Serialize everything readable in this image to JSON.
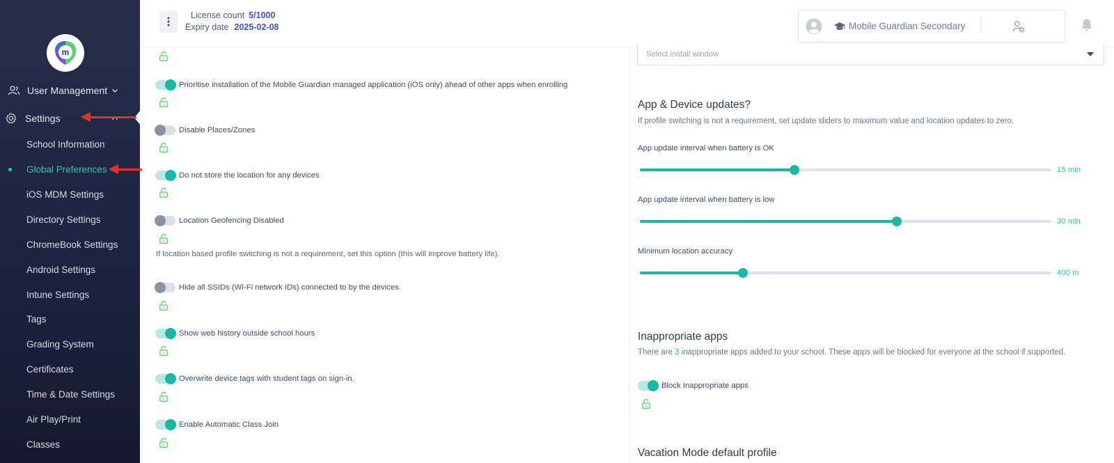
{
  "sidebar": {
    "user_management": "User Management",
    "settings": "Settings",
    "sub_items": [
      "School Information",
      "Global Preferences",
      "iOS MDM Settings",
      "Directory Settings",
      "ChromeBook Settings",
      "Android Settings",
      "Intune Settings",
      "Tags",
      "Grading System",
      "Certificates",
      "Time & Date Settings",
      "Air Play/Print",
      "Classes"
    ],
    "active_item": "Global Preferences"
  },
  "header": {
    "license_label": "License count",
    "license_value": "5/1000",
    "expiry_label": "Expiry date",
    "expiry_value": "2025-02-08",
    "school_name": "Mobile Guardian Secondary"
  },
  "left_settings": [
    {
      "label": "Prioritise installation of the Mobile Guardian managed application (iOS only) ahead of other apps when enrolling",
      "enabled": true
    },
    {
      "label": "Disable Places/Zones",
      "enabled": false
    },
    {
      "label": "Do not store the location for any devices",
      "enabled": true
    },
    {
      "label": "Location Geofencing Disabled",
      "enabled": false
    },
    {
      "label": "Hide all SSIDs (Wi-Fi network IDs) connected to by the devices.",
      "enabled": false
    },
    {
      "label": "Show web history outside school hours",
      "enabled": true
    },
    {
      "label": "Overwrite device tags with student tags on sign-in.",
      "enabled": true
    },
    {
      "label": "Enable Automatic Class Join",
      "enabled": true
    }
  ],
  "geofencing_note": "If location based profile switching is not a requirement, set this option (this will improve battery life).",
  "right": {
    "install_window_placeholder": "Select install window",
    "updates_title": "App & Device updates?",
    "updates_desc": "If profile switching is not a requirement, set update sliders to maximum value and location updates to zero.",
    "sliders": [
      {
        "label": "App update interval when battery is OK",
        "value_text": "15 min",
        "fraction": 0.375
      },
      {
        "label": "App update interval when battery is low",
        "value_text": "30 min",
        "fraction": 0.625
      },
      {
        "label": "Minimum location accuracy",
        "value_text": "400 m",
        "fraction": 0.25
      }
    ],
    "inappropriate_title": "Inappropriate apps",
    "inappropriate_desc_pre": "There are",
    "inappropriate_count": "3",
    "inappropriate_desc_post": "inappropriate apps added to your school. These apps will be blocked for everyone at the school if supported.",
    "block_label": "Block Inappropriate apps",
    "block_enabled": true,
    "vacation_title": "Vacation Mode default profile"
  },
  "colors": {
    "accent": "#17b9a4",
    "arrow": "#e8321f",
    "link": "#3f51d6"
  }
}
